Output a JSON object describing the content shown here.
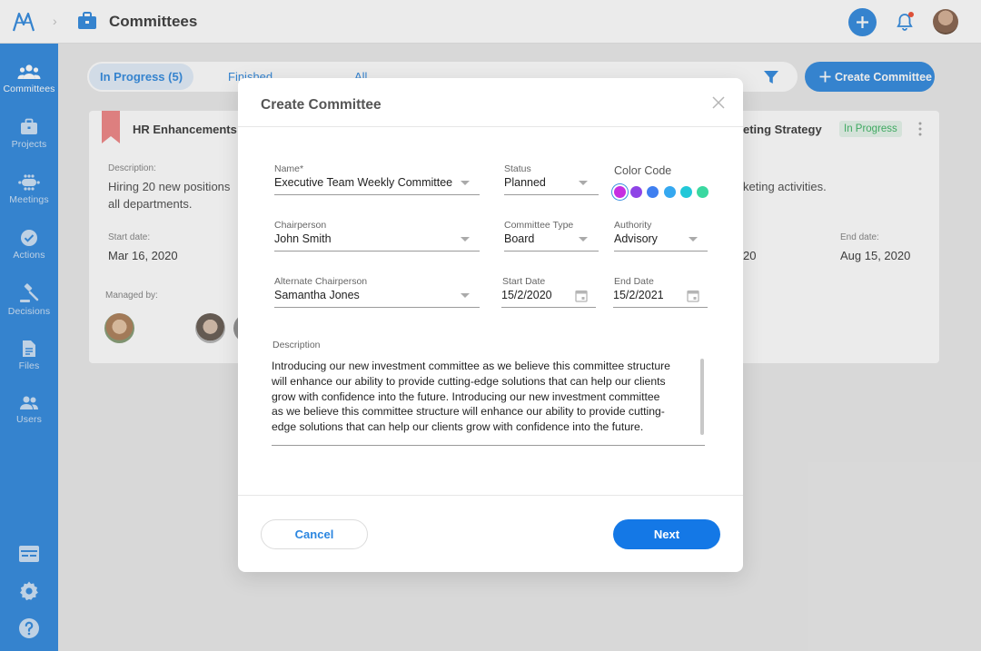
{
  "header": {
    "title": "Committees"
  },
  "sidebar": {
    "items": [
      {
        "label": "Committees"
      },
      {
        "label": "Projects"
      },
      {
        "label": "Meetings"
      },
      {
        "label": "Actions"
      },
      {
        "label": "Decisions"
      },
      {
        "label": "Files"
      },
      {
        "label": "Users"
      }
    ]
  },
  "tabs": [
    {
      "label": "In Progress (5)"
    },
    {
      "label": "Finished"
    },
    {
      "label": "All"
    }
  ],
  "create_button": "Create Committee",
  "card": {
    "title": "HR Enhancements",
    "description_label": "Description:",
    "description": "Hiring 20 new positions across all departments.",
    "description_line1": "Hiring 20 new positions",
    "description_line2": "all departments.",
    "start_label": "Start date:",
    "start_date": "Mar 16, 2020",
    "managed_label": "Managed by:"
  },
  "card2": {
    "title": "eting Strategy",
    "status": "In Progress",
    "description_fragment": "keting activities.",
    "start_fragment": "20",
    "end_label": "End date:",
    "end_date": "Aug 15, 2020"
  },
  "modal": {
    "title": "Create Committee",
    "fields": {
      "name": {
        "label": "Name*",
        "value": "Executive Team Weekly Committee"
      },
      "status": {
        "label": "Status",
        "value": "Planned"
      },
      "color_code": {
        "label": "Color Code"
      },
      "chairperson": {
        "label": "Chairperson",
        "value": "John Smith"
      },
      "committee_type": {
        "label": "Committee Type",
        "value": "Board"
      },
      "authority": {
        "label": "Authority",
        "value": "Advisory"
      },
      "alternate_chairperson": {
        "label": "Alternate Chairperson",
        "value": "Samantha Jones"
      },
      "start_date": {
        "label": "Start Date",
        "value": "15/2/2020"
      },
      "end_date": {
        "label": "End Date",
        "value": "15/2/2021"
      },
      "description": {
        "label": "Description",
        "value": "Introducing our new investment committee as we believe this committee structure will enhance our ability to provide cutting-edge solutions that can help our clients grow with confidence into the future. Introducing our new investment committee as we believe this committee structure will enhance our ability to provide cutting-edge solutions that can help our clients grow with confidence into the future."
      }
    },
    "colors": [
      "#c62ee0",
      "#8e44e6",
      "#3f7ff0",
      "#35a8f0",
      "#22c8d8",
      "#3ad8a0"
    ],
    "selected_color_index": 0,
    "cancel_label": "Cancel",
    "next_label": "Next"
  }
}
